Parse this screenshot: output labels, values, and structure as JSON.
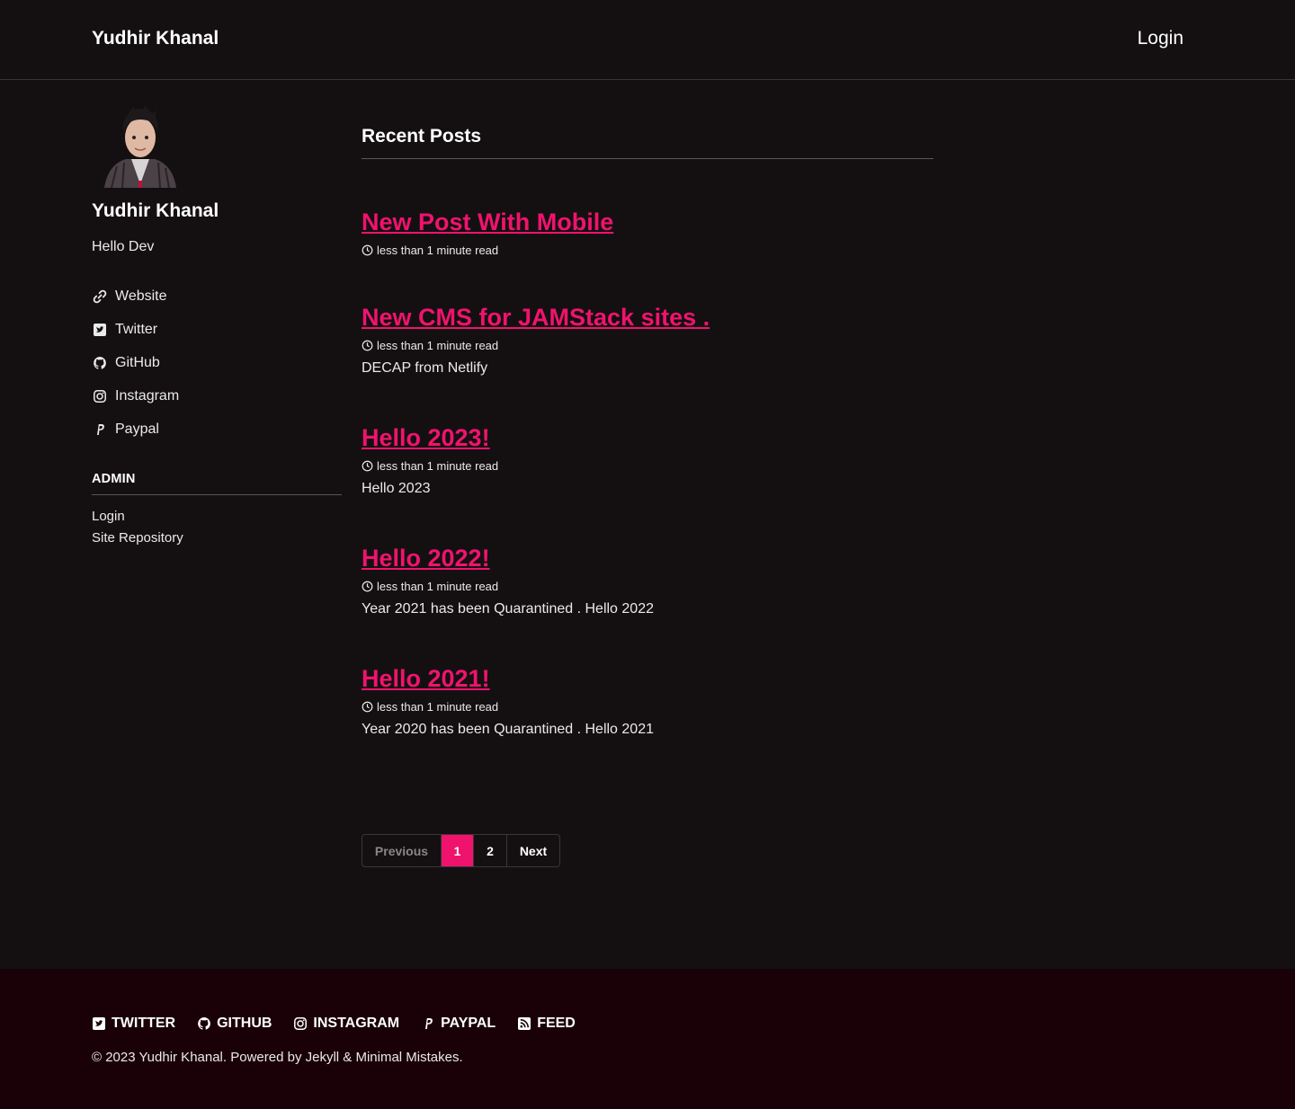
{
  "masthead": {
    "site_title": "Yudhir Khanal",
    "nav_login": "Login"
  },
  "author": {
    "name": "Yudhir Khanal",
    "bio": "Hello Dev",
    "links": [
      {
        "label": "Website",
        "icon": "link-icon"
      },
      {
        "label": "Twitter",
        "icon": "twitter-square-icon"
      },
      {
        "label": "GitHub",
        "icon": "github-icon"
      },
      {
        "label": "Instagram",
        "icon": "instagram-icon"
      },
      {
        "label": "Paypal",
        "icon": "paypal-icon"
      }
    ]
  },
  "sidebar_nav": {
    "heading": "ADMIN",
    "items": [
      "Login",
      "Site Repository"
    ]
  },
  "main": {
    "section_title": "Recent Posts",
    "posts": [
      {
        "title": "New Post With Mobile",
        "meta": "less than 1 minute read",
        "excerpt": ""
      },
      {
        "title": "New CMS for JAMStack sites .",
        "meta": "less than 1 minute read",
        "excerpt": "DECAP from Netlify"
      },
      {
        "title": "Hello 2023!",
        "meta": "less than 1 minute read",
        "excerpt": "Hello 2023"
      },
      {
        "title": "Hello 2022!",
        "meta": "less than 1 minute read",
        "excerpt": "Year 2021 has been Quarantined . Hello 2022"
      },
      {
        "title": "Hello 2021!",
        "meta": "less than 1 minute read",
        "excerpt": "Year 2020 has been Quarantined . Hello 2021"
      }
    ]
  },
  "pagination": {
    "previous": "Previous",
    "page1": "1",
    "page2": "2",
    "next": "Next"
  },
  "footer": {
    "links": [
      {
        "label": "Twitter",
        "icon": "twitter-square-icon"
      },
      {
        "label": "GitHub",
        "icon": "github-icon"
      },
      {
        "label": "Instagram",
        "icon": "instagram-icon"
      },
      {
        "label": "Paypal",
        "icon": "paypal-icon"
      },
      {
        "label": "Feed",
        "icon": "rss-icon"
      }
    ],
    "copyright_prefix": "© 2023 Yudhir Khanal. Powered by ",
    "jekyll": "Jekyll",
    "amp": " & ",
    "minimal_mistakes": "Minimal Mistakes",
    "period": "."
  },
  "colors": {
    "accent": "#f0136d",
    "background": "#141011",
    "footer_background": "#1a0108"
  }
}
